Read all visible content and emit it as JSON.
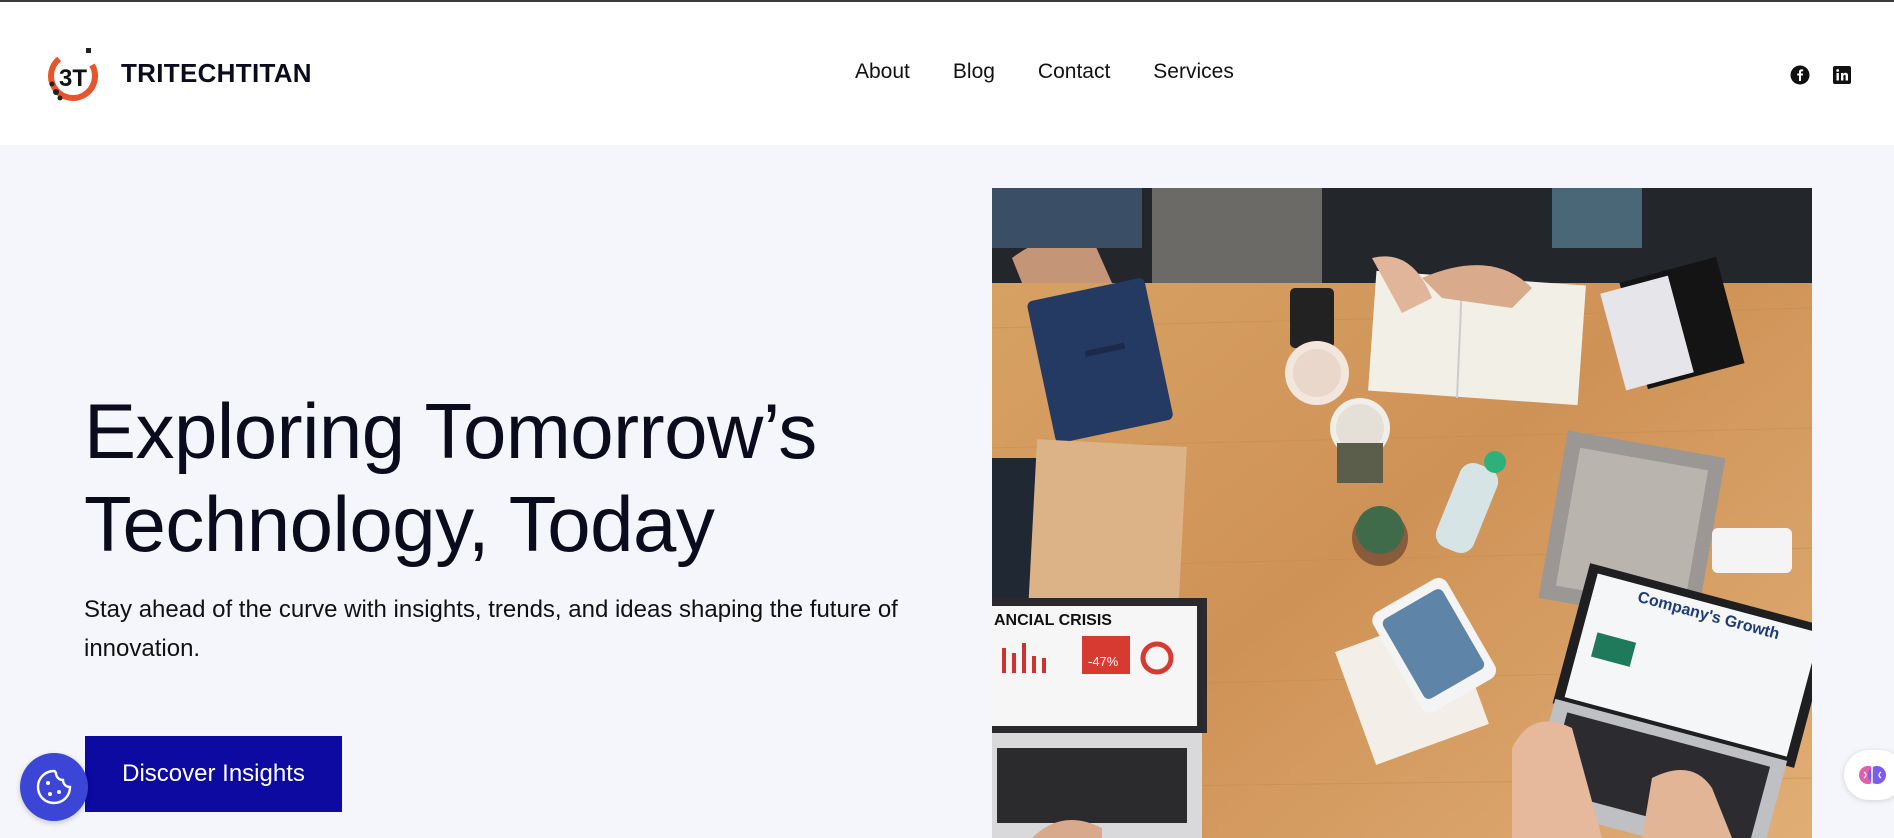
{
  "brand": {
    "name": "TRITECHTITAN",
    "logo_icon": "tritechtitan-logo-icon"
  },
  "nav": {
    "items": [
      {
        "label": "About"
      },
      {
        "label": "Blog"
      },
      {
        "label": "Contact"
      },
      {
        "label": "Services"
      }
    ]
  },
  "social": {
    "facebook_icon": "facebook-icon",
    "linkedin_icon": "linkedin-icon"
  },
  "hero": {
    "title_line1": "Exploring Tomorrow’s",
    "title_line2": "Technology, Today",
    "subtitle": "Stay ahead of the curve with insights, trends, and ideas shaping the future of innovation.",
    "cta_label": "Discover Insights"
  },
  "photo": {
    "laptop_left_text": "ANCIAL CRISIS",
    "laptop_right_text": "Company's Growth",
    "stock_badge": "-47%"
  },
  "widgets": {
    "cookie_icon": "cookie-icon",
    "brain_icon": "brain-icon"
  },
  "colors": {
    "cta": "#0c0aa0",
    "accent_logo": "#e8542b",
    "cookie": "#3b45d6",
    "hero_bg": "#f5f6fb"
  }
}
